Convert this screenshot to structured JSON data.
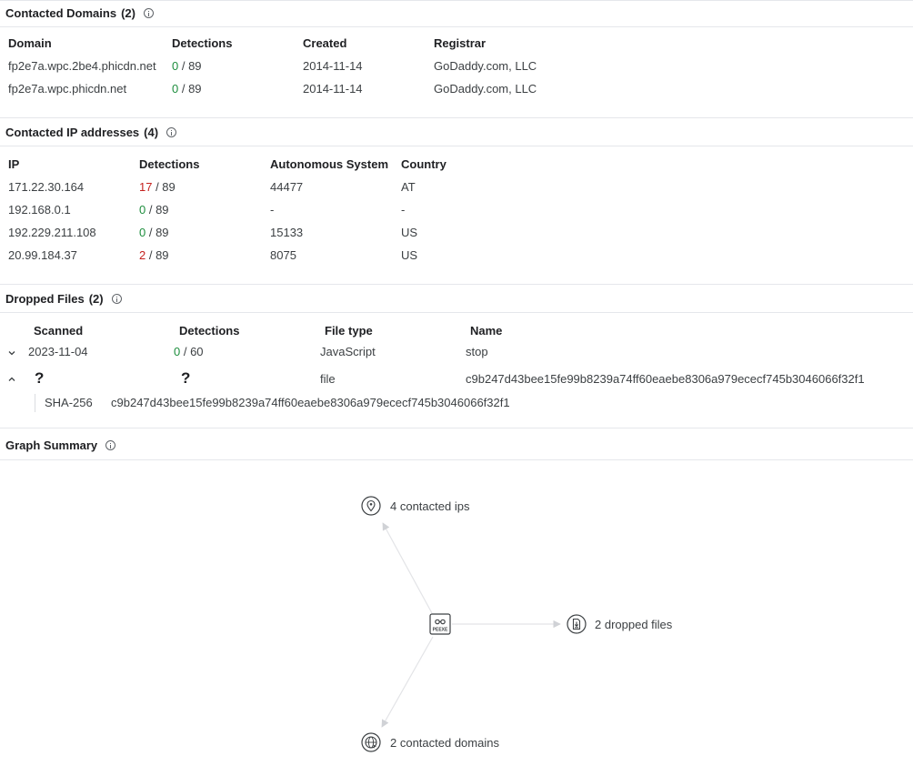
{
  "contacted_domains": {
    "title": "Contacted Domains",
    "count": "(2)",
    "columns": [
      "Domain",
      "Detections",
      "Created",
      "Registrar"
    ],
    "rows": [
      {
        "domain": "fp2e7a.wpc.2be4.phicdn.net",
        "det": "0",
        "total": " / 89",
        "created": "2014-11-14",
        "registrar": "GoDaddy.com, LLC"
      },
      {
        "domain": "fp2e7a.wpc.phicdn.net",
        "det": "0",
        "total": " / 89",
        "created": "2014-11-14",
        "registrar": "GoDaddy.com, LLC"
      }
    ]
  },
  "contacted_ips": {
    "title": "Contacted IP addresses",
    "count": "(4)",
    "columns": [
      "IP",
      "Detections",
      "Autonomous System",
      "Country"
    ],
    "rows": [
      {
        "ip": "171.22.30.164",
        "det": "17",
        "total": " / 89",
        "as": "44477",
        "country": "AT"
      },
      {
        "ip": "192.168.0.1",
        "det": "0",
        "total": " / 89",
        "as": "-",
        "country": "-"
      },
      {
        "ip": "192.229.211.108",
        "det": "0",
        "total": " / 89",
        "as": "15133",
        "country": "US"
      },
      {
        "ip": "20.99.184.37",
        "det": "2",
        "total": " / 89",
        "as": "8075",
        "country": "US"
      }
    ]
  },
  "dropped_files": {
    "title": "Dropped Files",
    "count": "(2)",
    "columns": [
      "Scanned",
      "Detections",
      "File type",
      "Name"
    ],
    "rows": [
      {
        "scanned": "2023-11-04",
        "det": "0",
        "total": " / 60",
        "type": "JavaScript",
        "name": "stop"
      },
      {
        "scanned": "?",
        "det": "?",
        "type": "file",
        "name": "c9b247d43bee15fe99b8239a74ff60eaebe8306a979ececf745b3046066f32f1"
      }
    ],
    "sha_label": "SHA-256",
    "sha_value": "c9b247d43bee15fe99b8239a74ff60eaebe8306a979ececf745b3046066f32f1"
  },
  "graph_summary": {
    "title": "Graph Summary",
    "center_label": "PEEXE",
    "nodes": {
      "ips": "4 contacted ips",
      "files": "2 dropped files",
      "domains": "2 contacted domains"
    }
  },
  "colors": {
    "clean": "#1e8e3e",
    "malicious": "#c5221f"
  },
  "icons": [
    "info-icon",
    "chevron-down-icon",
    "chevron-up-icon",
    "ip-pin-icon",
    "dropped-file-icon",
    "domain-globe-icon",
    "peexe-file-icon"
  ]
}
